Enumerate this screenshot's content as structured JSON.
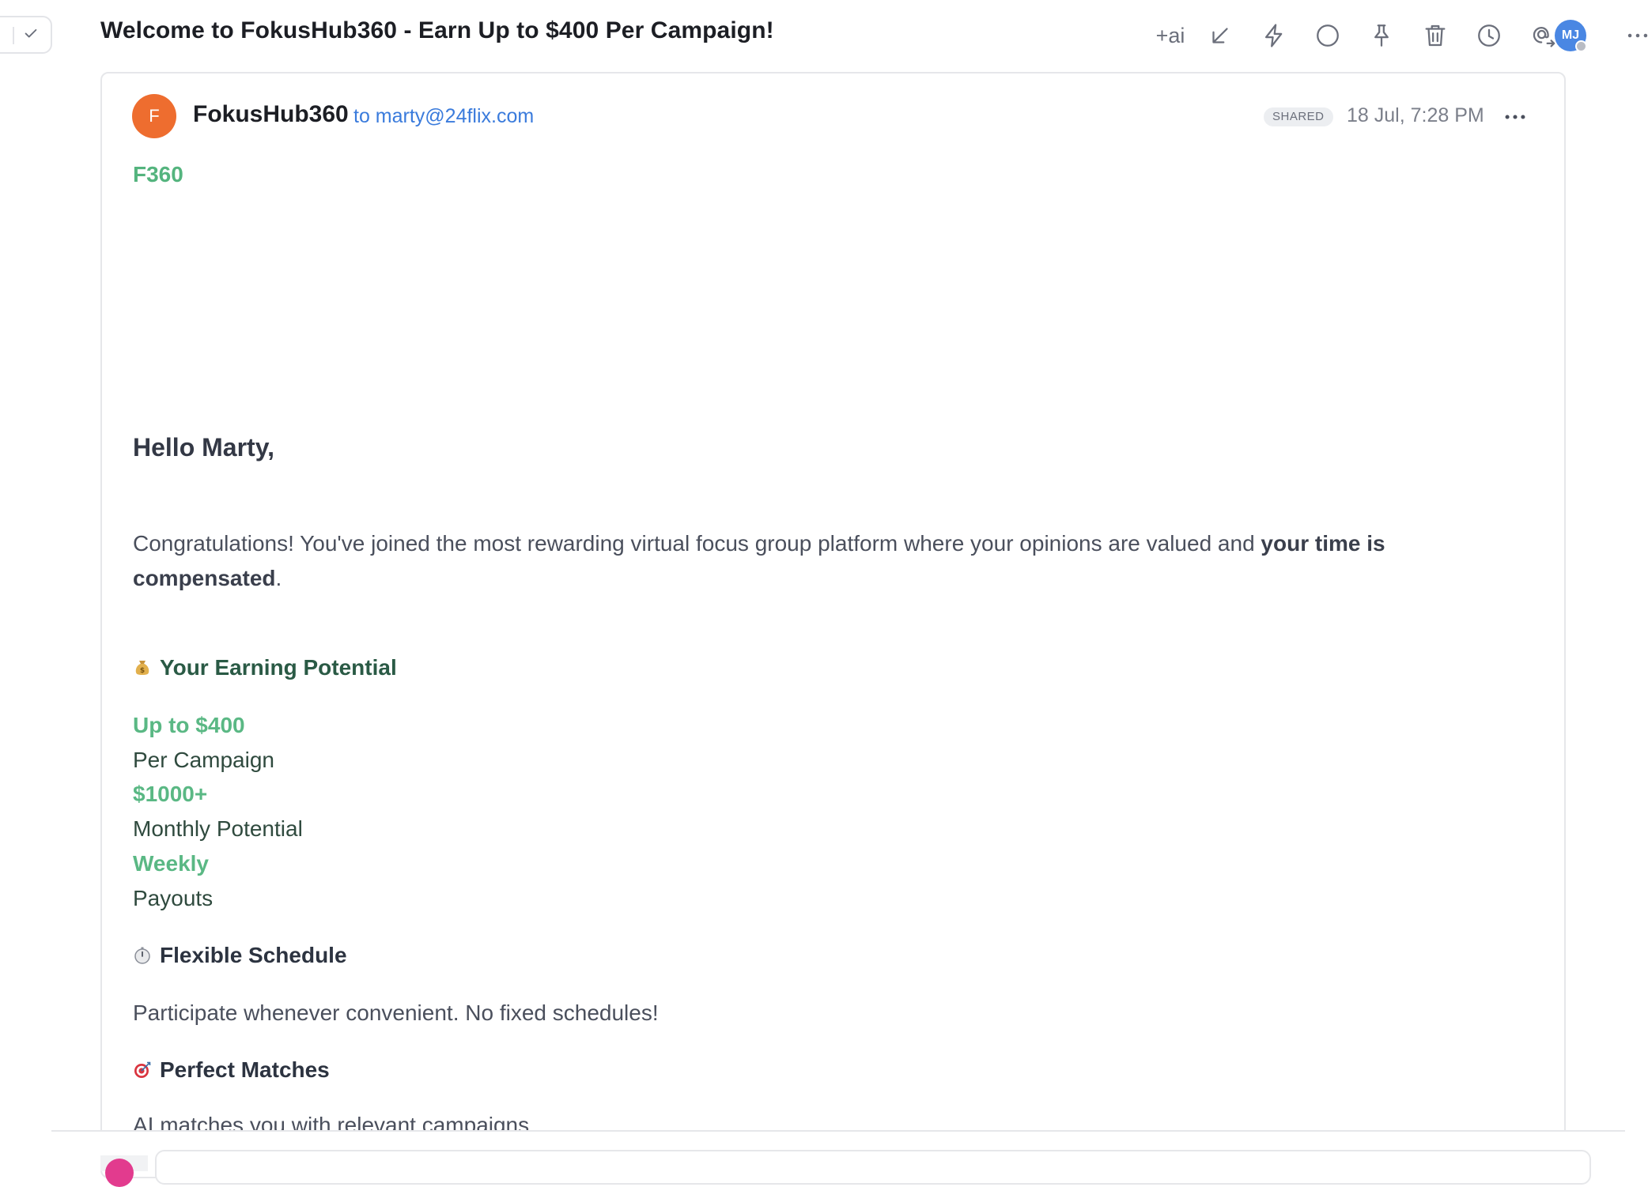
{
  "header": {
    "subject": "Welcome to FokusHub360 - Earn Up to $400 Per Campaign!",
    "toolbar": {
      "ai_label": "+ai",
      "icons": [
        "move-to-inbox-icon",
        "lightning-icon",
        "circle-icon",
        "pin-icon",
        "trash-icon",
        "clock-icon",
        "mention-forward-icon",
        "more-icon"
      ]
    },
    "user_avatar_initials": "MJ"
  },
  "message": {
    "sender_initial": "F",
    "sender_name": "FokusHub360",
    "recipient": "to marty@24flix.com",
    "badge": "SHARED",
    "date": "18 Jul, 7:28 PM",
    "body": {
      "brand": "F360",
      "greeting": "Hello Marty,",
      "intro_text": "Congratulations! You've joined the most rewarding virtual focus group platform where your opinions are valued and ",
      "intro_bold": "your time is compensated",
      "intro_end": ".",
      "earning_heading": "Your Earning Potential",
      "stats": [
        {
          "value": "Up to $400",
          "label": "Per Campaign"
        },
        {
          "value": "$1000+",
          "label": "Monthly Potential"
        },
        {
          "value": "Weekly",
          "label": "Payouts"
        }
      ],
      "flexible_heading": "Flexible Schedule",
      "flexible_text": "Participate whenever convenient. No fixed schedules!",
      "matches_heading": "Perfect Matches",
      "matches_text": "AI matches you with relevant campaigns"
    }
  },
  "colors": {
    "accent_green": "#5ab884",
    "dark_green": "#2a5a45",
    "link_blue": "#3a7bdc",
    "sender_avatar": "#ee6d2f",
    "user_avatar": "#4a87e3"
  }
}
